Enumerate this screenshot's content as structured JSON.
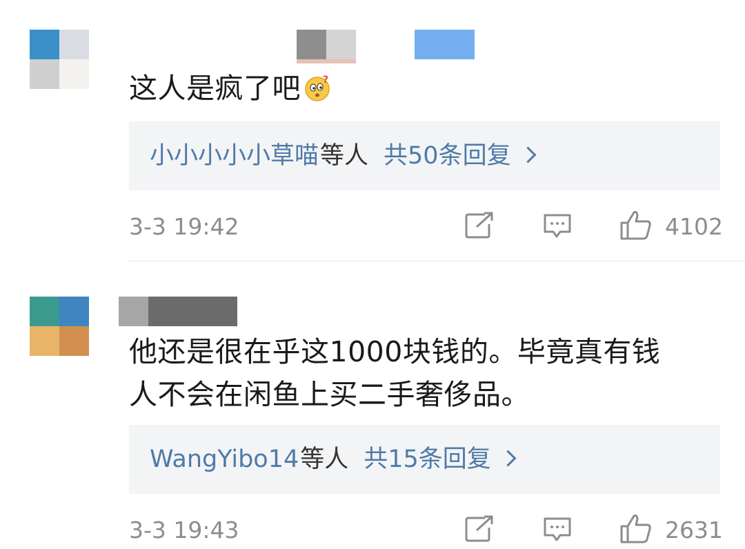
{
  "comments": [
    {
      "text": "这人是疯了吧",
      "emoji": "confused-face-emoji",
      "reply_names": "小小小小小草喵",
      "reply_suffix": "等人",
      "reply_count": "共50条回复",
      "time": "3-3 19:42",
      "likes": "4102"
    },
    {
      "text_line1": "他还是很在乎这1000块钱的。毕竟真有钱",
      "text_line2": "人不会在闲鱼上买二手奢侈品。",
      "reply_names": "WangYibo14",
      "reply_suffix": "等人",
      "reply_count": "共15条回复",
      "time": "3-3 19:43",
      "likes": "2631"
    }
  ],
  "icons": {
    "share": "share-icon",
    "comment": "comment-icon",
    "like": "thumbs-up-icon",
    "chevron": "chevron-right-icon"
  },
  "colors": {
    "link": "#4f7aa8",
    "text": "#1a1a1a",
    "meta": "#8c8c8c",
    "reply_bg": "#f3f4f6"
  }
}
